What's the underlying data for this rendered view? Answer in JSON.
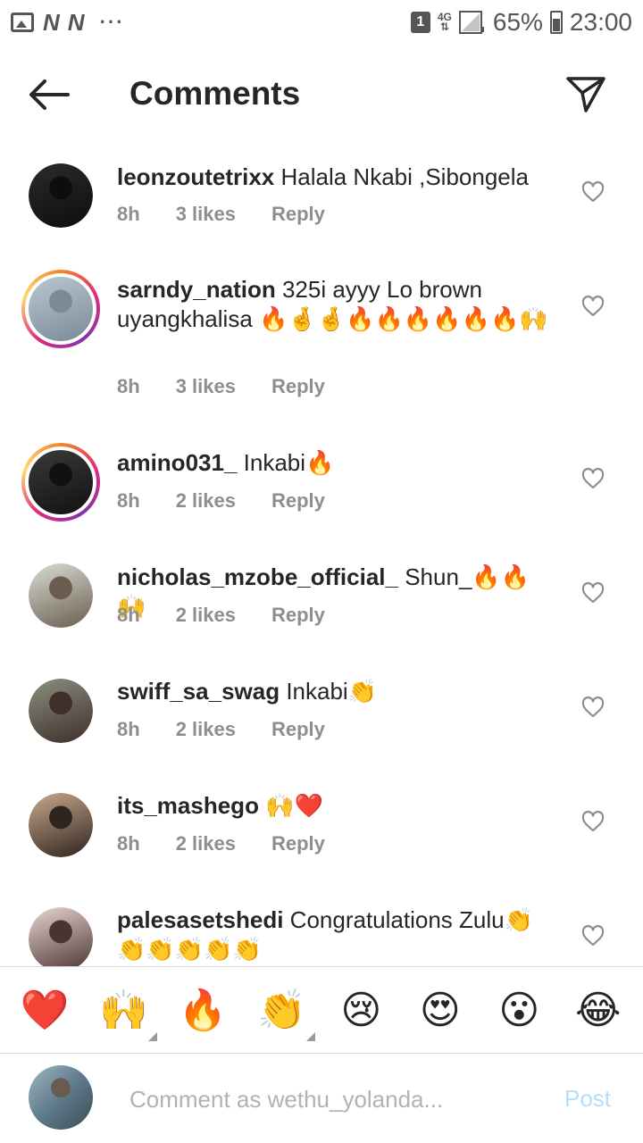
{
  "status_bar": {
    "left_icons": [
      "image-icon",
      "n-icon",
      "n-icon",
      "more-dots-icon"
    ],
    "sim": "1",
    "network": "4G",
    "battery": "65%",
    "time": "23:00"
  },
  "header": {
    "title": "Comments",
    "back_icon": "arrow-left-icon",
    "share_icon": "send-icon"
  },
  "comments": [
    {
      "user": "leonzoutetrixx",
      "text": "Halala Nkabi ,Sibongela",
      "time": "8h",
      "likes": "3 likes",
      "reply": "Reply",
      "story_ring": false,
      "avatar_colors": [
        "#2b2b2b",
        "#0d0d0d"
      ]
    },
    {
      "user": "sarndy_nation",
      "text": "325i ayyy Lo brown uyangkhalisa 🔥🤞🤞🔥🔥🔥🔥🔥🔥🙌",
      "time": "8h",
      "likes": "3 likes",
      "reply": "Reply",
      "story_ring": true,
      "avatar_colors": [
        "#b9c7d2",
        "#7a8a96"
      ]
    },
    {
      "user": "amino031_",
      "text": "Inkabi🔥",
      "time": "8h",
      "likes": "2 likes",
      "reply": "Reply",
      "story_ring": true,
      "avatar_colors": [
        "#3a3a3a",
        "#111111"
      ]
    },
    {
      "user": "nicholas_mzobe_official_",
      "text": "Shun_🔥🔥🙌",
      "time": "8h",
      "likes": "2 likes",
      "reply": "Reply",
      "story_ring": false,
      "avatar_colors": [
        "#d8ddd4",
        "#6a5d4f"
      ]
    },
    {
      "user": "swiff_sa_swag",
      "text": "Inkabi👏",
      "time": "8h",
      "likes": "2 likes",
      "reply": "Reply",
      "story_ring": false,
      "avatar_colors": [
        "#8a8f80",
        "#3f2f28"
      ]
    },
    {
      "user": "its_mashego",
      "text": "🙌❤️",
      "time": "8h",
      "likes": "2 likes",
      "reply": "Reply",
      "story_ring": false,
      "avatar_colors": [
        "#c9a98a",
        "#2e2420"
      ]
    },
    {
      "user": "palesasetshedi",
      "text": "Congratulations Zulu👏👏👏👏👏👏",
      "time": "",
      "likes": "",
      "reply": "",
      "story_ring": false,
      "avatar_colors": [
        "#e7d6cf",
        "#4a3430"
      ]
    }
  ],
  "emoji_bar": [
    {
      "emoji": "❤️",
      "variants": false
    },
    {
      "emoji": "🙌",
      "variants": true
    },
    {
      "emoji": "🔥",
      "variants": false
    },
    {
      "emoji": "👏",
      "variants": true
    },
    {
      "emoji": "😢",
      "variants": false
    },
    {
      "emoji": "😍",
      "variants": false
    },
    {
      "emoji": "😮",
      "variants": false
    },
    {
      "emoji": "😂",
      "variants": false
    }
  ],
  "compose": {
    "placeholder": "Comment as wethu_yolanda...",
    "post_label": "Post"
  },
  "colors": {
    "text": "#262626",
    "meta": "#8e8e8e",
    "post_disabled": "#b2dffc",
    "divider": "#dbdbdb"
  }
}
